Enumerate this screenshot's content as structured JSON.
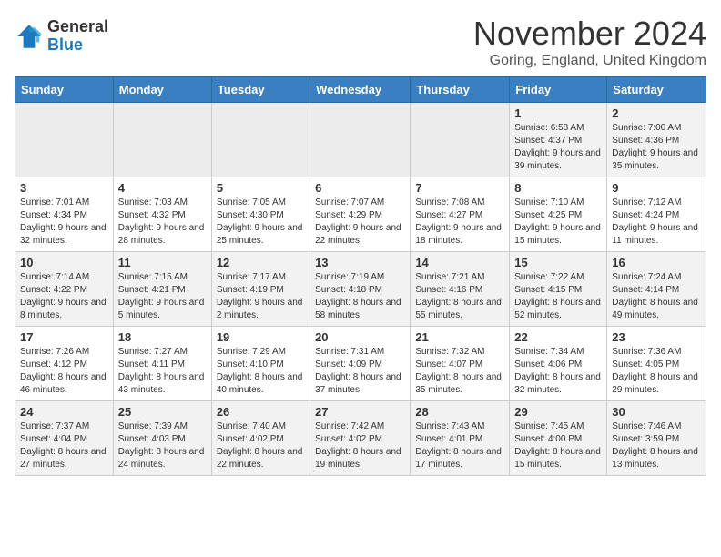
{
  "logo": {
    "general": "General",
    "blue": "Blue"
  },
  "title": "November 2024",
  "location": "Goring, England, United Kingdom",
  "weekdays": [
    "Sunday",
    "Monday",
    "Tuesday",
    "Wednesday",
    "Thursday",
    "Friday",
    "Saturday"
  ],
  "rows": [
    [
      {
        "day": "",
        "info": ""
      },
      {
        "day": "",
        "info": ""
      },
      {
        "day": "",
        "info": ""
      },
      {
        "day": "",
        "info": ""
      },
      {
        "day": "",
        "info": ""
      },
      {
        "day": "1",
        "info": "Sunrise: 6:58 AM\nSunset: 4:37 PM\nDaylight: 9 hours and 39 minutes."
      },
      {
        "day": "2",
        "info": "Sunrise: 7:00 AM\nSunset: 4:36 PM\nDaylight: 9 hours and 35 minutes."
      }
    ],
    [
      {
        "day": "3",
        "info": "Sunrise: 7:01 AM\nSunset: 4:34 PM\nDaylight: 9 hours and 32 minutes."
      },
      {
        "day": "4",
        "info": "Sunrise: 7:03 AM\nSunset: 4:32 PM\nDaylight: 9 hours and 28 minutes."
      },
      {
        "day": "5",
        "info": "Sunrise: 7:05 AM\nSunset: 4:30 PM\nDaylight: 9 hours and 25 minutes."
      },
      {
        "day": "6",
        "info": "Sunrise: 7:07 AM\nSunset: 4:29 PM\nDaylight: 9 hours and 22 minutes."
      },
      {
        "day": "7",
        "info": "Sunrise: 7:08 AM\nSunset: 4:27 PM\nDaylight: 9 hours and 18 minutes."
      },
      {
        "day": "8",
        "info": "Sunrise: 7:10 AM\nSunset: 4:25 PM\nDaylight: 9 hours and 15 minutes."
      },
      {
        "day": "9",
        "info": "Sunrise: 7:12 AM\nSunset: 4:24 PM\nDaylight: 9 hours and 11 minutes."
      }
    ],
    [
      {
        "day": "10",
        "info": "Sunrise: 7:14 AM\nSunset: 4:22 PM\nDaylight: 9 hours and 8 minutes."
      },
      {
        "day": "11",
        "info": "Sunrise: 7:15 AM\nSunset: 4:21 PM\nDaylight: 9 hours and 5 minutes."
      },
      {
        "day": "12",
        "info": "Sunrise: 7:17 AM\nSunset: 4:19 PM\nDaylight: 9 hours and 2 minutes."
      },
      {
        "day": "13",
        "info": "Sunrise: 7:19 AM\nSunset: 4:18 PM\nDaylight: 8 hours and 58 minutes."
      },
      {
        "day": "14",
        "info": "Sunrise: 7:21 AM\nSunset: 4:16 PM\nDaylight: 8 hours and 55 minutes."
      },
      {
        "day": "15",
        "info": "Sunrise: 7:22 AM\nSunset: 4:15 PM\nDaylight: 8 hours and 52 minutes."
      },
      {
        "day": "16",
        "info": "Sunrise: 7:24 AM\nSunset: 4:14 PM\nDaylight: 8 hours and 49 minutes."
      }
    ],
    [
      {
        "day": "17",
        "info": "Sunrise: 7:26 AM\nSunset: 4:12 PM\nDaylight: 8 hours and 46 minutes."
      },
      {
        "day": "18",
        "info": "Sunrise: 7:27 AM\nSunset: 4:11 PM\nDaylight: 8 hours and 43 minutes."
      },
      {
        "day": "19",
        "info": "Sunrise: 7:29 AM\nSunset: 4:10 PM\nDaylight: 8 hours and 40 minutes."
      },
      {
        "day": "20",
        "info": "Sunrise: 7:31 AM\nSunset: 4:09 PM\nDaylight: 8 hours and 37 minutes."
      },
      {
        "day": "21",
        "info": "Sunrise: 7:32 AM\nSunset: 4:07 PM\nDaylight: 8 hours and 35 minutes."
      },
      {
        "day": "22",
        "info": "Sunrise: 7:34 AM\nSunset: 4:06 PM\nDaylight: 8 hours and 32 minutes."
      },
      {
        "day": "23",
        "info": "Sunrise: 7:36 AM\nSunset: 4:05 PM\nDaylight: 8 hours and 29 minutes."
      }
    ],
    [
      {
        "day": "24",
        "info": "Sunrise: 7:37 AM\nSunset: 4:04 PM\nDaylight: 8 hours and 27 minutes."
      },
      {
        "day": "25",
        "info": "Sunrise: 7:39 AM\nSunset: 4:03 PM\nDaylight: 8 hours and 24 minutes."
      },
      {
        "day": "26",
        "info": "Sunrise: 7:40 AM\nSunset: 4:02 PM\nDaylight: 8 hours and 22 minutes."
      },
      {
        "day": "27",
        "info": "Sunrise: 7:42 AM\nSunset: 4:02 PM\nDaylight: 8 hours and 19 minutes."
      },
      {
        "day": "28",
        "info": "Sunrise: 7:43 AM\nSunset: 4:01 PM\nDaylight: 8 hours and 17 minutes."
      },
      {
        "day": "29",
        "info": "Sunrise: 7:45 AM\nSunset: 4:00 PM\nDaylight: 8 hours and 15 minutes."
      },
      {
        "day": "30",
        "info": "Sunrise: 7:46 AM\nSunset: 3:59 PM\nDaylight: 8 hours and 13 minutes."
      }
    ]
  ]
}
